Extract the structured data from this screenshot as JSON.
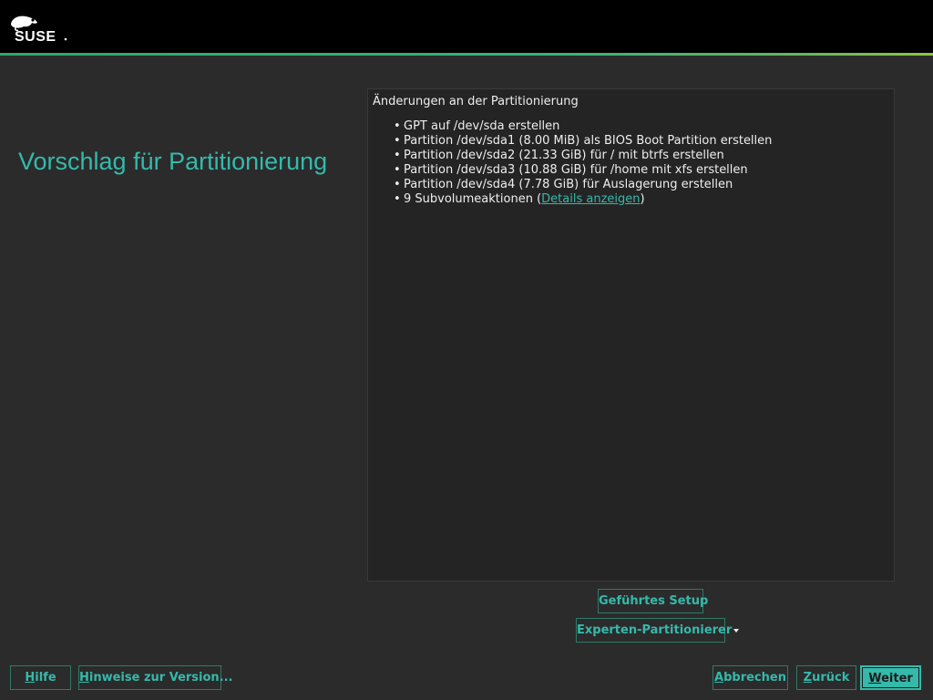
{
  "header": {
    "logo_text": "SUSE"
  },
  "page": {
    "title": "Vorschlag für Partitionierung"
  },
  "summary": {
    "heading": "Änderungen an der Partitionierung",
    "items": [
      "GPT auf /dev/sda erstellen",
      "Partition /dev/sda1 (8.00 MiB) als BIOS Boot Partition erstellen",
      "Partition /dev/sda2 (21.33 GiB) für / mit btrfs erstellen",
      "Partition /dev/sda3 (10.88 GiB) für /home mit xfs erstellen",
      "Partition /dev/sda4 (7.78 GiB) für Auslagerung erstellen"
    ],
    "subvolume_prefix": "9 Subvolumeaktionen (",
    "subvolume_link": "Details anzeigen",
    "subvolume_suffix": ")"
  },
  "actions": {
    "guided_setup_label": "Geführtes Setup",
    "expert_partitioner_label": "Experten-Partitionierer"
  },
  "footer": {
    "help_label_mnemonic": "H",
    "help_label_rest": "ilfe",
    "release_notes_mnemonic": "H",
    "release_notes_rest": "inweise zur Version...",
    "abort_mnemonic": "A",
    "abort_rest": "bbrechen",
    "back_mnemonic": "Z",
    "back_rest": "urück",
    "next_mnemonic": "W",
    "next_rest": "eiter"
  },
  "icons": {
    "logo": "suse-chameleon-logo",
    "dropdown": "caret-down-icon"
  },
  "colors": {
    "accent": "#35b9ab",
    "background": "#2b2b2b",
    "panel": "#242424",
    "topbar": "#000000",
    "text": "#eeeeee"
  }
}
